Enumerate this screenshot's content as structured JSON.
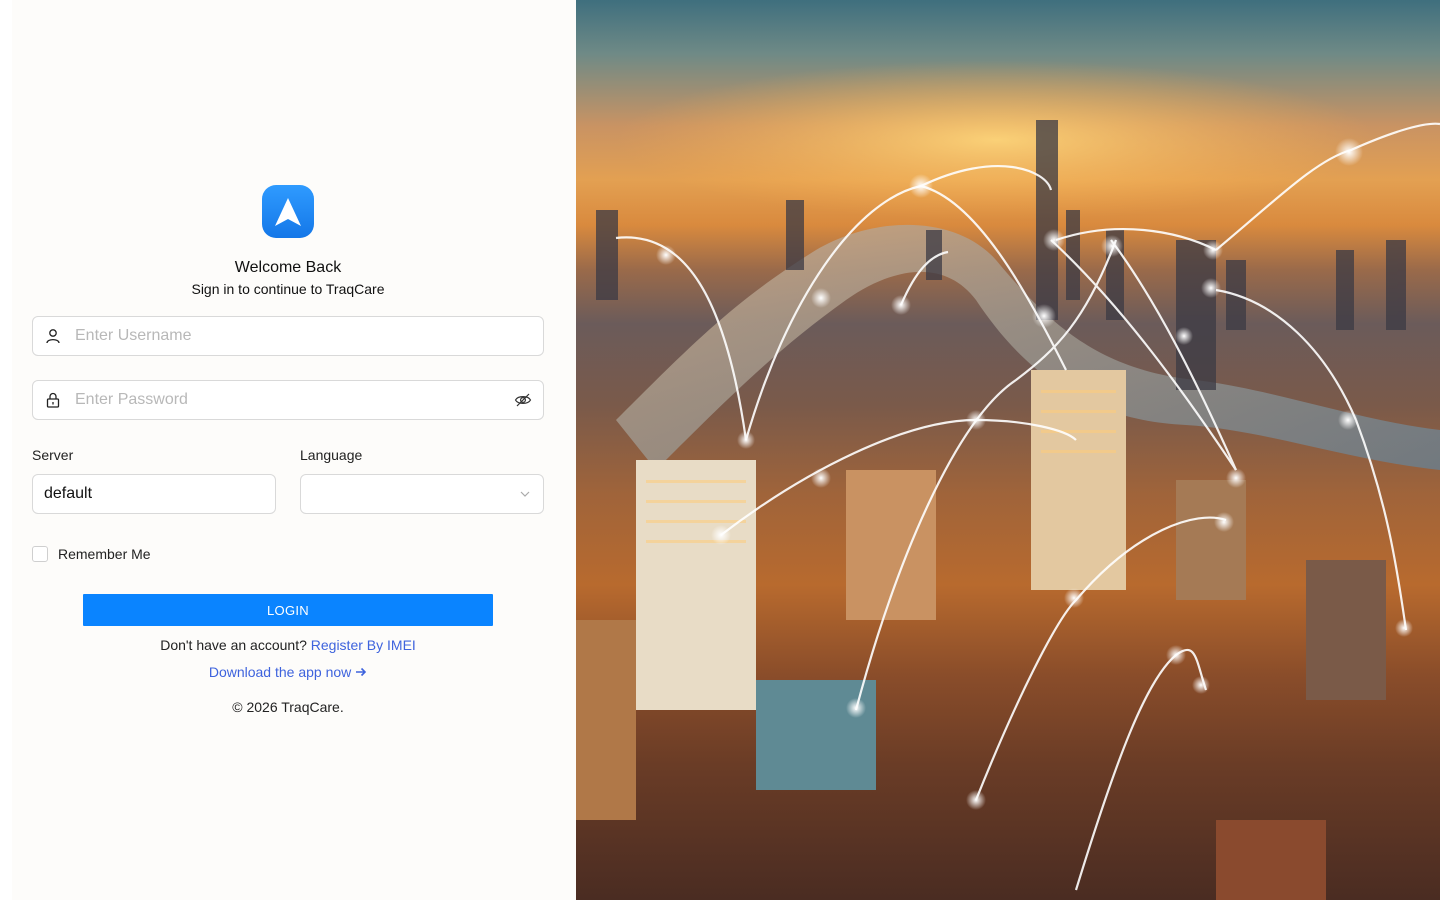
{
  "welcome": {
    "title": "Welcome Back",
    "subtitle": "Sign in to continue to TraqCare"
  },
  "form": {
    "username_placeholder": "Enter Username",
    "password_placeholder": "Enter Password",
    "server_label": "Server",
    "server_value": "default",
    "language_label": "Language",
    "language_value": "",
    "remember_label": "Remember Me",
    "remember_checked": false,
    "login_label": "LOGIN"
  },
  "footer": {
    "no_account_text": "Don't have an account?",
    "register_link": "Register By IMEI",
    "download_link": "Download the app now",
    "copyright": "© 2026 TraqCare."
  },
  "colors": {
    "accent": "#0a84ff",
    "link": "#3e63dd",
    "panel_bg": "#fdfcfa"
  },
  "icons": [
    "navigation-arrow-icon",
    "user-icon",
    "lock-icon",
    "eye-off-icon",
    "chevron-down-icon",
    "arrow-right-icon"
  ]
}
